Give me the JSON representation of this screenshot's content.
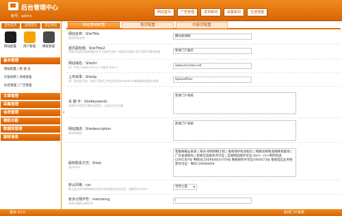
{
  "header": {
    "title": "后台管理中心",
    "account_label": "帐号：admin",
    "nav": [
      "网站首页",
      "广告管理",
      "发布新闻",
      "采集新闻",
      "生成地图"
    ]
  },
  "sidebar": {
    "quick": [
      "后台首页",
      "返回首页",
      "安全退出"
    ],
    "icons": [
      {
        "label": "网站配置",
        "icon": "site-config-icon",
        "color": "#1d1d1d"
      },
      {
        "label": "用户管理",
        "icon": "user-manage-icon",
        "color": "#f5a300"
      },
      {
        "label": "模板管理",
        "icon": "template-manage-icon",
        "color": "#4a4a4a"
      }
    ],
    "basic_title": "基本管理",
    "basic_items": [
      "网站配置 | 管 理 员",
      "外部调用 | 风格管理",
      "标签管理 | 广告管理"
    ],
    "sections": [
      "文章管理",
      "采集管理",
      "会员管理",
      "辅助功能",
      "数据库管理",
      "版权信息"
    ]
  },
  "tabs": [
    "网站整体配置",
    "首页配置",
    "内容页配置"
  ],
  "form": {
    "fields": [
      {
        "label": "网站名称：SiteTitle",
        "hint": "您的网站名称",
        "value": "腾讯新闻网"
      },
      {
        "label": "首页副标题：SiteTitle2",
        "hint": "用来分组首页副标题的文字,可放也可能一组网站关键字,用于搜索引擎的收录",
        "value": "新闻门户展示"
      },
      {
        "label": "网站域名：SiteUrl",
        "hint": "如：http://www.cms.cn 不要加 http://",
        "value": "www.zzcodes.net"
      },
      {
        "label": "上传目录：SiteUp",
        "hint": "如：更改此目录，请到下面的上传目录名和webeditor编辑器的配置中修改",
        "value": "UploadFiles"
      },
      {
        "label": "关 键 字：SiteKeywords",
        "hint": "关键字为搜索引擎收录使用，以英文逗号分隔",
        "value": "新闻门户系统"
      },
      {
        "label": "网站描述：Sitedescription",
        "hint": "网站的描述",
        "value": "新闻门户系统"
      },
      {
        "label": "版权联系方式：Siteb",
        "hint": "支持html",
        "value": "客服邮箱@某某 | 阳光·绿色网络工程 | 版权保护投诉指引 | 网络法制和道德教育基地 | 广东省通管局 | 新闻信息服务许可证 | 互联网出版许可证<br/> <li>粤府新函[2001]87号 粤网文[2009]0463-070号 网络视听许可证1904073号 增值电信业务经营许可证：粤B2-20090059"
      },
      {
        "label": "默认风格：css",
        "hint": "默认显示的风格和被会员选中的风格会存在区别，请使用Cookies",
        "value": "世界之窗"
      },
      {
        "label": "有多分隔字符：memanng",
        "hint": "有多分隔的分隔字符",
        "value": "|"
      }
    ]
  },
  "footer": {
    "version": "版本 V2.0",
    "system": "新闻门户系统"
  }
}
